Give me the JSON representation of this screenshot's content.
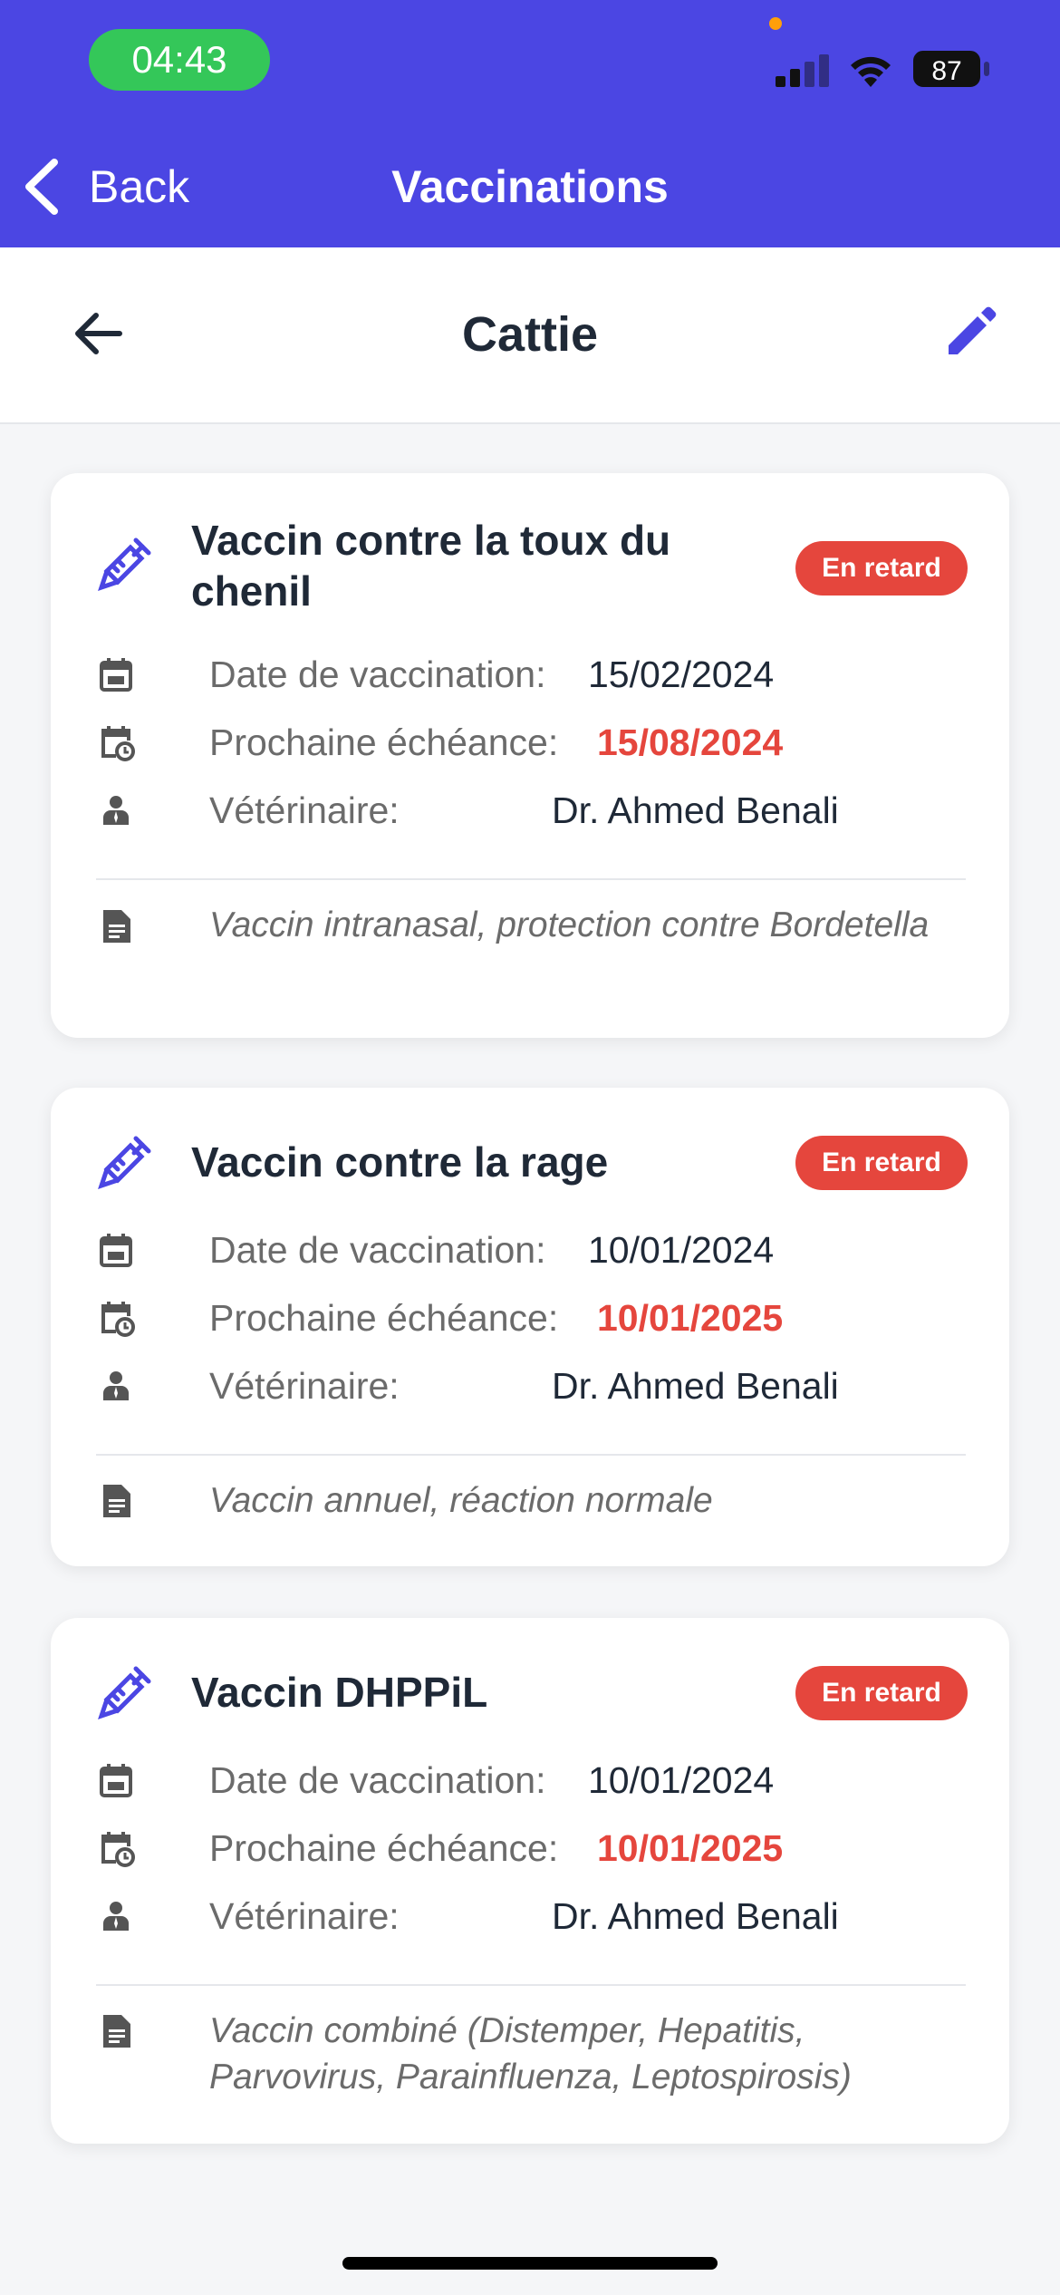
{
  "status_bar": {
    "time": "04:43",
    "battery": "87"
  },
  "nav": {
    "back_label": "Back",
    "title": "Vaccinations"
  },
  "header": {
    "title": "Cattie"
  },
  "labels": {
    "date": "Date de vaccination:",
    "next": "Prochaine échéance:",
    "vet": "Vétérinaire:"
  },
  "colors": {
    "accent": "#4b46e3",
    "overdue": "#e5463d"
  },
  "vaccinations": [
    {
      "name": "Vaccin contre la toux du chenil",
      "status": "En retard",
      "date": "15/02/2024",
      "next_due": "15/08/2024",
      "vet": "Dr. Ahmed Benali",
      "note": "Vaccin intranasal, protection contre Bordetella"
    },
    {
      "name": "Vaccin contre la rage",
      "status": "En retard",
      "date": "10/01/2024",
      "next_due": "10/01/2025",
      "vet": "Dr. Ahmed Benali",
      "note": "Vaccin annuel, réaction normale"
    },
    {
      "name": "Vaccin DHPPiL",
      "status": "En retard",
      "date": "10/01/2024",
      "next_due": "10/01/2025",
      "vet": "Dr. Ahmed Benali",
      "note": "Vaccin combiné (Distemper, Hepatitis, Parvovirus, Parainfluenza, Leptospirosis)"
    }
  ]
}
